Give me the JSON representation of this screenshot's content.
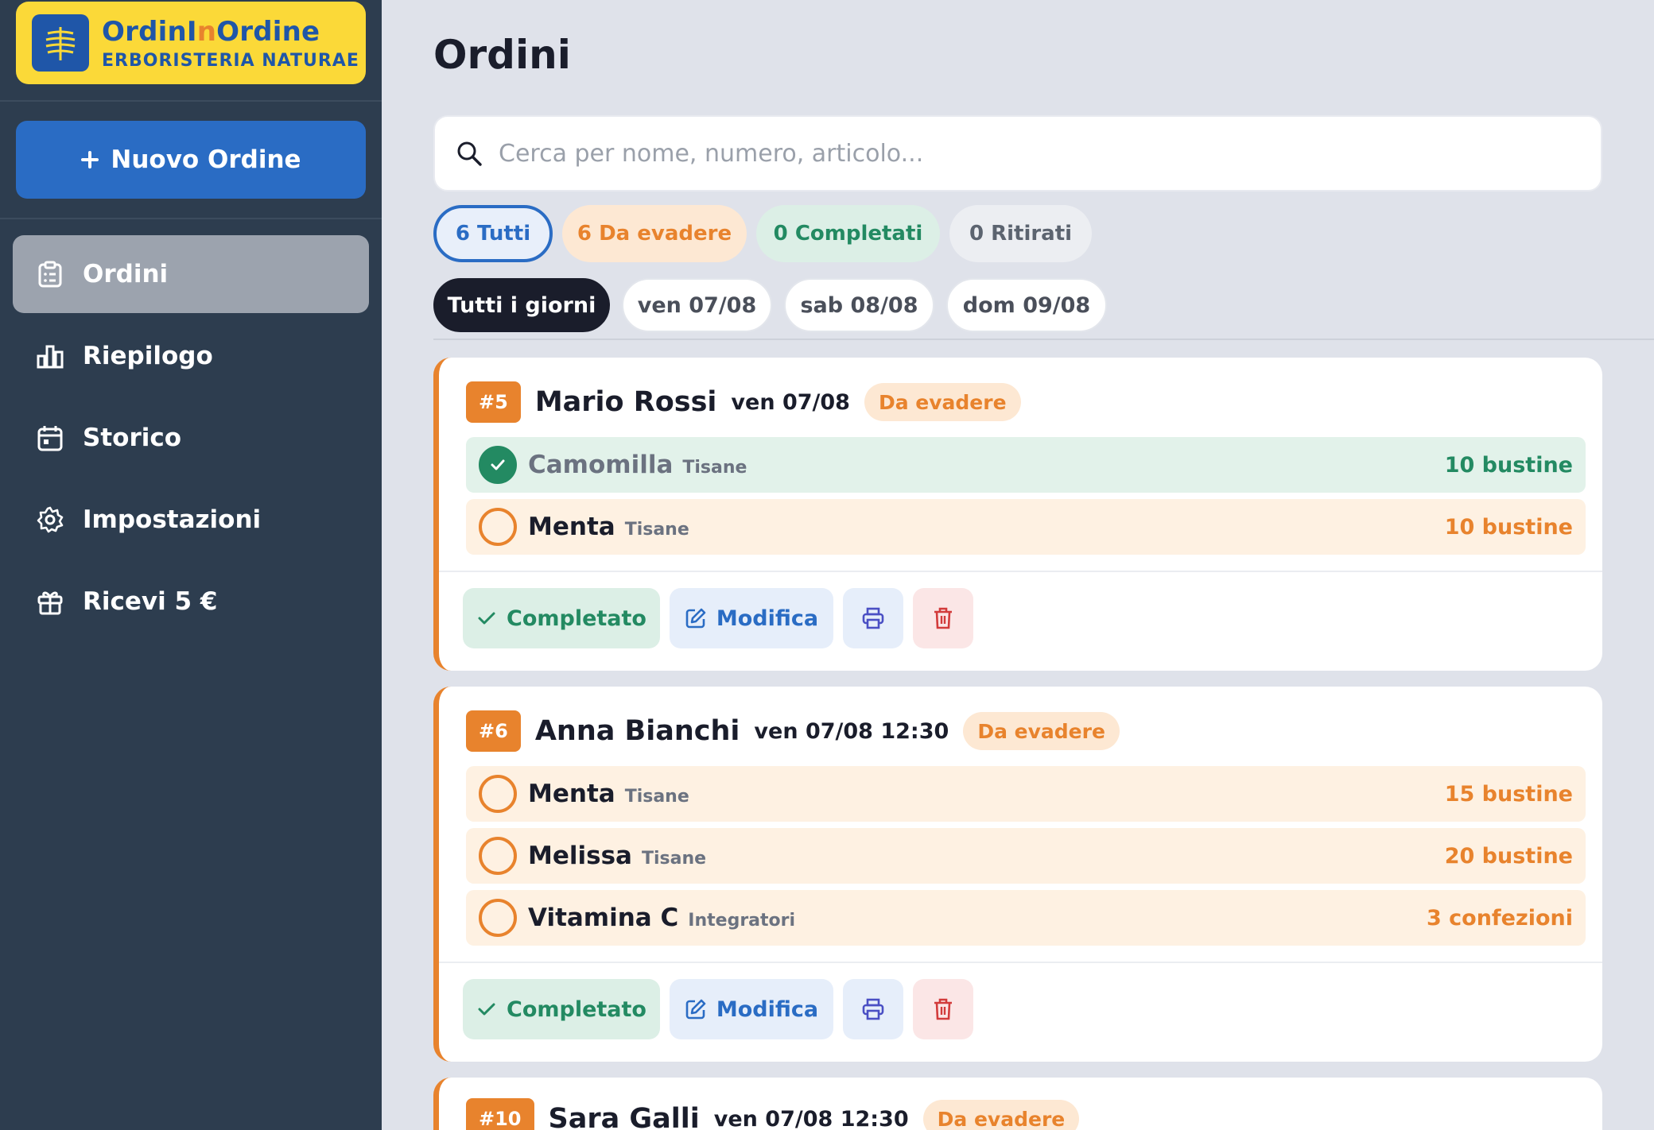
{
  "app": {
    "logo_title_a": "OrdinI",
    "logo_title_b": "n",
    "logo_title_c": "Ordine",
    "logo_subtitle": "ERBORISTERIA NATURAE"
  },
  "sidebar": {
    "new_order": "Nuovo Ordine",
    "items": [
      {
        "label": "Ordini",
        "icon": "clipboard-icon",
        "active": true
      },
      {
        "label": "Riepilogo",
        "icon": "bar-chart-icon"
      },
      {
        "label": "Storico",
        "icon": "calendar-icon"
      },
      {
        "label": "Impostazioni",
        "icon": "gear-icon"
      },
      {
        "label": "Ricevi 5 €",
        "icon": "gift-icon"
      }
    ]
  },
  "main": {
    "title": "Ordini",
    "search_placeholder": "Cerca per nome, numero, articolo...",
    "status_filters": [
      "6 Tutti",
      "6 Da evadere",
      "0 Completati",
      "0 Ritirati"
    ],
    "day_filters": [
      "Tutti i giorni",
      "ven 07/08",
      "sab 08/08",
      "dom 09/08"
    ]
  },
  "orders": [
    {
      "number": "#5",
      "name": "Mario Rossi",
      "date": "ven 07/08",
      "status": "Da evadere",
      "items": [
        {
          "name": "Camomilla",
          "category": "Tisane",
          "qty": "10 bustine",
          "done": true
        },
        {
          "name": "Menta",
          "category": "Tisane",
          "qty": "10 bustine",
          "done": false
        }
      ]
    },
    {
      "number": "#6",
      "name": "Anna Bianchi",
      "date": "ven 07/08 12:30",
      "status": "Da evadere",
      "items": [
        {
          "name": "Menta",
          "category": "Tisane",
          "qty": "15 bustine",
          "done": false
        },
        {
          "name": "Melissa",
          "category": "Tisane",
          "qty": "20 bustine",
          "done": false
        },
        {
          "name": "Vitamina C",
          "category": "Integratori",
          "qty": "3 confezioni",
          "done": false
        }
      ]
    },
    {
      "number": "#10",
      "name": "Sara Galli",
      "date": "ven 07/08 12:30",
      "status": "Da evadere",
      "items": []
    }
  ],
  "actions": {
    "complete": "Completato",
    "edit": "Modifica"
  },
  "colors": {
    "sidebar_bg": "#2d3d4f",
    "brand_blue": "#2a6cc4",
    "logo_yellow": "#fbd938",
    "orange": "#e8832d",
    "green": "#238a62"
  }
}
